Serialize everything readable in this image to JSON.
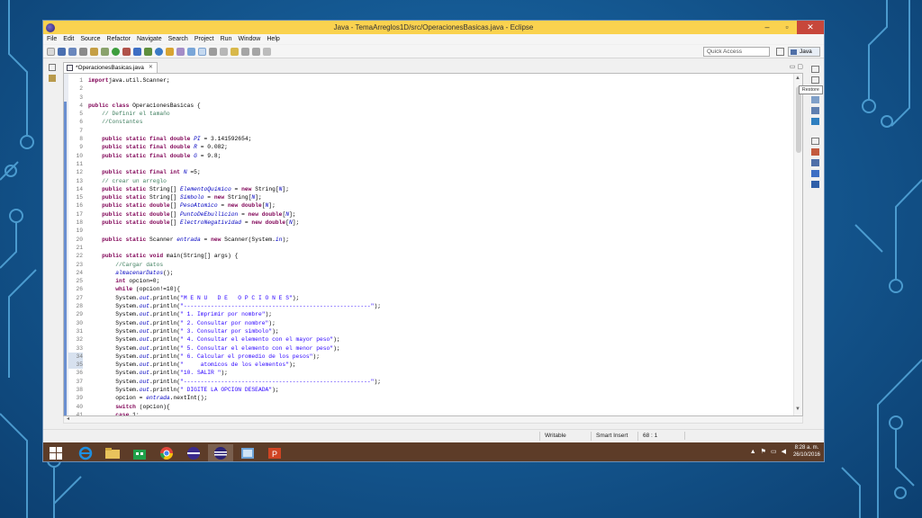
{
  "window": {
    "title": "Java - TemaArreglos1D/src/OperacionesBasicas.java - Eclipse",
    "controls": [
      "–",
      "▫",
      "✕"
    ]
  },
  "menu": [
    "File",
    "Edit",
    "Source",
    "Refactor",
    "Navigate",
    "Search",
    "Project",
    "Run",
    "Window",
    "Help"
  ],
  "toolbar": {
    "quick_access": "Quick Access",
    "perspective": "Java"
  },
  "editor": {
    "tab_title": "*OperacionesBasicas.java",
    "tab_close": "✕",
    "tab_min": "▭",
    "tab_max": "▢",
    "tooltip": "Restore",
    "lines": [
      {
        "n": "1",
        "tokens": [
          [
            "kw",
            "import"
          ],
          [
            "",
            "java.util.Scanner;"
          ]
        ]
      },
      {
        "n": "2",
        "tokens": []
      },
      {
        "n": "3",
        "tokens": []
      },
      {
        "n": "4",
        "tokens": [
          [
            "kw",
            "public class"
          ],
          [
            "",
            " OperacionesBasicas {"
          ]
        ]
      },
      {
        "n": "5",
        "tokens": [
          [
            "",
            "    "
          ],
          [
            "cm",
            "// Definir el tamaño"
          ]
        ]
      },
      {
        "n": "6",
        "tokens": [
          [
            "",
            "    "
          ],
          [
            "cm",
            "//Constantes"
          ]
        ]
      },
      {
        "n": "7",
        "tokens": []
      },
      {
        "n": "8",
        "tokens": [
          [
            "",
            "    "
          ],
          [
            "kw",
            "public static final double"
          ],
          [
            "",
            " "
          ],
          [
            "fi",
            "PI"
          ],
          [
            "",
            " = 3.141592654;"
          ]
        ]
      },
      {
        "n": "9",
        "tokens": [
          [
            "",
            "    "
          ],
          [
            "kw",
            "public static final double"
          ],
          [
            "",
            " "
          ],
          [
            "fi",
            "R"
          ],
          [
            "",
            " = 0.082;"
          ]
        ]
      },
      {
        "n": "10",
        "tokens": [
          [
            "",
            "    "
          ],
          [
            "kw",
            "public static final double"
          ],
          [
            "",
            " "
          ],
          [
            "fi",
            "G"
          ],
          [
            "",
            " = 9.8;"
          ]
        ]
      },
      {
        "n": "11",
        "tokens": []
      },
      {
        "n": "12",
        "tokens": [
          [
            "",
            "    "
          ],
          [
            "kw",
            "public static final int"
          ],
          [
            "",
            " "
          ],
          [
            "fi",
            "N"
          ],
          [
            "",
            " =5;"
          ]
        ]
      },
      {
        "n": "13",
        "tokens": [
          [
            "",
            "    "
          ],
          [
            "cm",
            "// crear un arreglo"
          ]
        ]
      },
      {
        "n": "14",
        "tokens": [
          [
            "",
            "    "
          ],
          [
            "kw",
            "public static"
          ],
          [
            "",
            " String[] "
          ],
          [
            "fi",
            "ElementoQuimico"
          ],
          [
            "",
            " = "
          ],
          [
            "kw",
            "new"
          ],
          [
            "",
            " String["
          ],
          [
            "fi",
            "N"
          ],
          [
            "",
            "];"
          ]
        ]
      },
      {
        "n": "15",
        "tokens": [
          [
            "",
            "    "
          ],
          [
            "kw",
            "public static"
          ],
          [
            "",
            " String[] "
          ],
          [
            "fi",
            "Simbolo"
          ],
          [
            "",
            " = "
          ],
          [
            "kw",
            "new"
          ],
          [
            "",
            " String["
          ],
          [
            "fi",
            "N"
          ],
          [
            "",
            "];"
          ]
        ]
      },
      {
        "n": "16",
        "tokens": [
          [
            "",
            "    "
          ],
          [
            "kw",
            "public static double"
          ],
          [
            "",
            "[] "
          ],
          [
            "fi",
            "PesoAtomico"
          ],
          [
            "",
            " = "
          ],
          [
            "kw",
            "new double"
          ],
          [
            "",
            "["
          ],
          [
            "fi",
            "N"
          ],
          [
            "",
            "];"
          ]
        ]
      },
      {
        "n": "17",
        "tokens": [
          [
            "",
            "    "
          ],
          [
            "kw",
            "public static double"
          ],
          [
            "",
            "[] "
          ],
          [
            "fi",
            "PuntoDeEbullicion"
          ],
          [
            "",
            " = "
          ],
          [
            "kw",
            "new double"
          ],
          [
            "",
            "["
          ],
          [
            "fi",
            "N"
          ],
          [
            "",
            "];"
          ]
        ]
      },
      {
        "n": "18",
        "tokens": [
          [
            "",
            "    "
          ],
          [
            "kw",
            "public static double"
          ],
          [
            "",
            "[] "
          ],
          [
            "fi",
            "ElectroNegatividad"
          ],
          [
            "",
            " = "
          ],
          [
            "kw",
            "new double"
          ],
          [
            "",
            "["
          ],
          [
            "fi",
            "N"
          ],
          [
            "",
            "];"
          ]
        ]
      },
      {
        "n": "19",
        "tokens": []
      },
      {
        "n": "20",
        "tokens": [
          [
            "",
            "    "
          ],
          [
            "kw",
            "public static"
          ],
          [
            "",
            " Scanner "
          ],
          [
            "fi",
            "entrada"
          ],
          [
            "",
            " = "
          ],
          [
            "kw",
            "new"
          ],
          [
            "",
            " Scanner(System."
          ],
          [
            "fi",
            "in"
          ],
          [
            "",
            ");"
          ]
        ]
      },
      {
        "n": "21",
        "tokens": []
      },
      {
        "n": "22",
        "tokens": [
          [
            "",
            "    "
          ],
          [
            "kw",
            "public static void"
          ],
          [
            "",
            " main(String[] args) {"
          ]
        ]
      },
      {
        "n": "23",
        "tokens": [
          [
            "",
            "        "
          ],
          [
            "cm",
            "//Cargar datos"
          ]
        ]
      },
      {
        "n": "24",
        "tokens": [
          [
            "",
            "        "
          ],
          [
            "fi",
            "almacenarDatos"
          ],
          [
            "",
            "();"
          ]
        ]
      },
      {
        "n": "25",
        "tokens": [
          [
            "",
            "        "
          ],
          [
            "kw",
            "int"
          ],
          [
            "",
            " opcion=0;"
          ]
        ]
      },
      {
        "n": "26",
        "tokens": [
          [
            "",
            "        "
          ],
          [
            "kw",
            "while"
          ],
          [
            "",
            " (opcion!=10){"
          ]
        ]
      },
      {
        "n": "27",
        "tokens": [
          [
            "",
            "        System."
          ],
          [
            "fi",
            "out"
          ],
          [
            "",
            ".println("
          ],
          [
            "st",
            "\"M E N U   D E   O P C I O N E S\""
          ],
          [
            "",
            ");"
          ]
        ]
      },
      {
        "n": "28",
        "tokens": [
          [
            "",
            "        System."
          ],
          [
            "fi",
            "out"
          ],
          [
            "",
            ".println("
          ],
          [
            "st",
            "\"-------------------------------------------------------\""
          ],
          [
            "",
            ");"
          ]
        ]
      },
      {
        "n": "29",
        "tokens": [
          [
            "",
            "        System."
          ],
          [
            "fi",
            "out"
          ],
          [
            "",
            ".println("
          ],
          [
            "st",
            "\" 1. Imprimir por nombre\""
          ],
          [
            "",
            ");"
          ]
        ]
      },
      {
        "n": "30",
        "tokens": [
          [
            "",
            "        System."
          ],
          [
            "fi",
            "out"
          ],
          [
            "",
            ".println("
          ],
          [
            "st",
            "\" 2. Consultar por nombre\""
          ],
          [
            "",
            ");"
          ]
        ]
      },
      {
        "n": "31",
        "tokens": [
          [
            "",
            "        System."
          ],
          [
            "fi",
            "out"
          ],
          [
            "",
            ".println("
          ],
          [
            "st",
            "\" 3. Consultar por simbolo\""
          ],
          [
            "",
            ");"
          ]
        ]
      },
      {
        "n": "32",
        "tokens": [
          [
            "",
            "        System."
          ],
          [
            "fi",
            "out"
          ],
          [
            "",
            ".println("
          ],
          [
            "st",
            "\" 4. Consultar el elemento con el mayor peso\""
          ],
          [
            "",
            ");"
          ]
        ]
      },
      {
        "n": "33",
        "tokens": [
          [
            "",
            "        System."
          ],
          [
            "fi",
            "out"
          ],
          [
            "",
            ".println("
          ],
          [
            "st",
            "\" 5. Consultar el elemento con el menor peso\""
          ],
          [
            "",
            ");"
          ]
        ]
      },
      {
        "n": "34",
        "tokens": [
          [
            "",
            "        System."
          ],
          [
            "fi",
            "out"
          ],
          [
            "",
            ".println("
          ],
          [
            "st",
            "\" 6. Calcular el promedio de los pesos\""
          ],
          [
            "",
            ");"
          ]
        ]
      },
      {
        "n": "35",
        "tokens": [
          [
            "",
            "        System."
          ],
          [
            "fi",
            "out"
          ],
          [
            "",
            ".println("
          ],
          [
            "st",
            "\"     atomicos de los elementos\""
          ],
          [
            "",
            ");"
          ]
        ]
      },
      {
        "n": "36",
        "tokens": [
          [
            "",
            "        System."
          ],
          [
            "fi",
            "out"
          ],
          [
            "",
            ".println("
          ],
          [
            "st",
            "\"10. SALIR \""
          ],
          [
            "",
            ");"
          ]
        ]
      },
      {
        "n": "37",
        "tokens": [
          [
            "",
            "        System."
          ],
          [
            "fi",
            "out"
          ],
          [
            "",
            ".println("
          ],
          [
            "st",
            "\"-------------------------------------------------------\""
          ],
          [
            "",
            ");"
          ]
        ]
      },
      {
        "n": "38",
        "tokens": [
          [
            "",
            "        System."
          ],
          [
            "fi",
            "out"
          ],
          [
            "",
            ".println("
          ],
          [
            "st",
            "\" DIGITE LA OPCION DESEADA\""
          ],
          [
            "",
            ");"
          ]
        ]
      },
      {
        "n": "39",
        "tokens": [
          [
            "",
            "        opcion = "
          ],
          [
            "fi",
            "entrada"
          ],
          [
            "",
            ".nextInt();"
          ]
        ]
      },
      {
        "n": "40",
        "tokens": [
          [
            "",
            "        "
          ],
          [
            "kw",
            "switch"
          ],
          [
            "",
            " (opcion){"
          ]
        ]
      },
      {
        "n": "41",
        "tokens": [
          [
            "",
            "        "
          ],
          [
            "kw",
            "case"
          ],
          [
            "",
            " 1:"
          ]
        ]
      }
    ]
  },
  "status": {
    "writable": "Writable",
    "insert_mode": "Smart Insert",
    "position": "68 : 1"
  },
  "taskbar": {
    "time": "8:28 a. m.",
    "date": "26/10/2016"
  },
  "colors": {
    "titlebar": "#fad24f",
    "taskbar": "#5d3c28",
    "keyword": "#7f0055",
    "comment": "#3f7f5f",
    "string": "#2a00ff",
    "field": "#0000c0"
  }
}
